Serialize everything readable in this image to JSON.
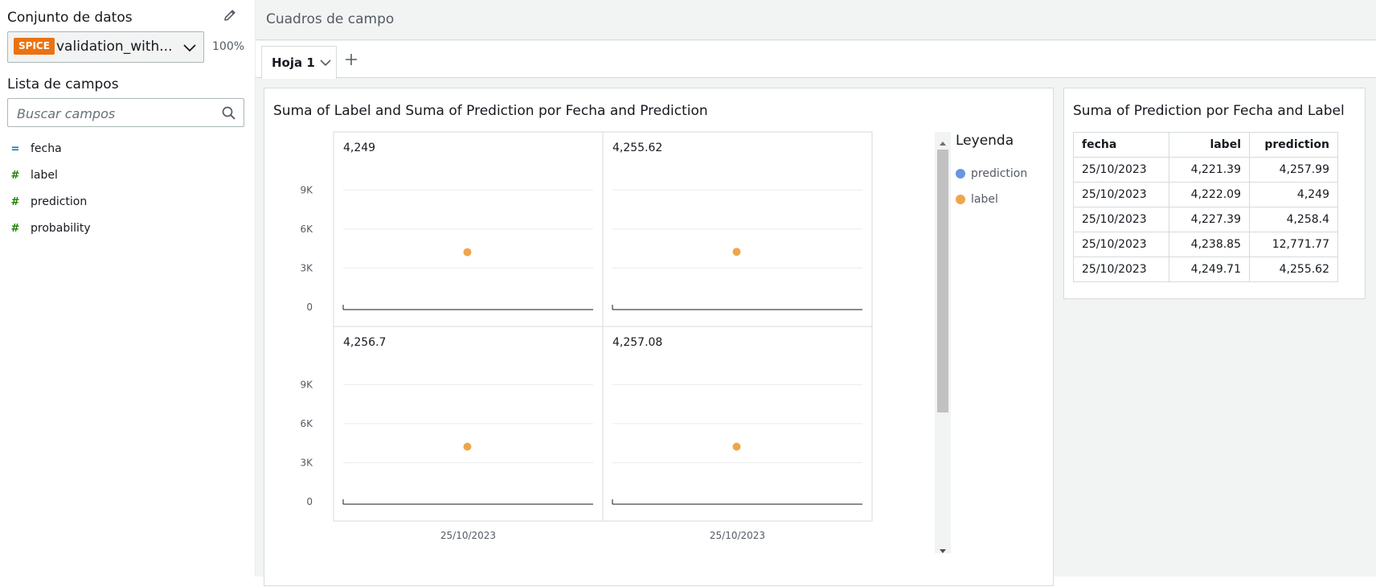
{
  "sidebar": {
    "dataset_title": "Conjunto de datos",
    "spice_badge": "SPICE",
    "dataset_name": "validation_with...",
    "spice_usage": "100%",
    "fields_title": "Lista de campos",
    "search_placeholder": "Buscar campos",
    "fields": [
      {
        "name": "fecha",
        "type_glyph": "=",
        "kind": "dimension"
      },
      {
        "name": "label",
        "type_glyph": "#",
        "kind": "measure"
      },
      {
        "name": "prediction",
        "type_glyph": "#",
        "kind": "measure"
      },
      {
        "name": "probability",
        "type_glyph": "#",
        "kind": "measure"
      }
    ]
  },
  "main": {
    "field_wells_label": "Cuadros de campo",
    "tabs": [
      {
        "label": "Hoja 1"
      }
    ]
  },
  "visual1": {
    "title": "Suma of Label and Suma of Prediction por Fecha and Prediction",
    "legend_title": "Leyenda",
    "legend": [
      {
        "label": "prediction",
        "color": "#6a95e0"
      },
      {
        "label": "label",
        "color": "#efa64b"
      }
    ]
  },
  "visual2": {
    "title": "Suma of Prediction por Fecha and Label",
    "columns": [
      "fecha",
      "label",
      "prediction"
    ],
    "rows": [
      [
        "25/10/2023",
        "4,221.39",
        "4,257.99"
      ],
      [
        "25/10/2023",
        "4,222.09",
        "4,249"
      ],
      [
        "25/10/2023",
        "4,227.39",
        "4,258.4"
      ],
      [
        "25/10/2023",
        "4,238.85",
        "12,771.77"
      ],
      [
        "25/10/2023",
        "4,249.71",
        "4,255.62"
      ]
    ]
  },
  "chart_data": {
    "type": "scatter",
    "title": "Suma of Label and Suma of Prediction por Fecha and Prediction",
    "ylim": [
      0,
      10500
    ],
    "y_ticks": [
      "0",
      "3K",
      "6K",
      "9K"
    ],
    "y_tick_values": [
      0,
      3000,
      6000,
      9000
    ],
    "grid": true,
    "legend_placement": "right",
    "panels": [
      {
        "label": "4,249",
        "x": "25/10/2023",
        "points": [
          {
            "series": "label",
            "y": 4222.09
          }
        ]
      },
      {
        "label": "4,255.62",
        "x": "25/10/2023",
        "points": [
          {
            "series": "label",
            "y": 4249.71
          }
        ]
      },
      {
        "label": "4,256.7",
        "x": "25/10/2023",
        "points": [
          {
            "series": "label",
            "y": 4230
          }
        ]
      },
      {
        "label": "4,257.08",
        "x": "25/10/2023",
        "points": [
          {
            "series": "label",
            "y": 4230
          }
        ]
      }
    ],
    "series_colors": {
      "prediction": "#6a95e0",
      "label": "#efa64b"
    }
  }
}
